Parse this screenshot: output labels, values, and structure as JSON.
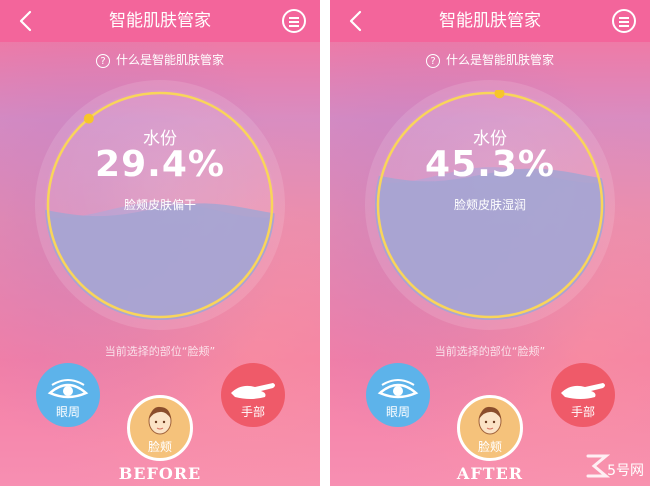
{
  "app": {
    "title": "智能肌肤管家",
    "help_text": "什么是智能肌肤管家",
    "help_icon": "?"
  },
  "panels": [
    {
      "metric_label": "水份",
      "metric_value": "29.4%",
      "moisture_fraction": 0.294,
      "status": "脸颊皮肤偏干",
      "selected_text": "当前选择的部位“脸颊”",
      "zones": {
        "eye": "眼周",
        "face": "脸颊",
        "hand": "手部"
      },
      "caption": "BEFORE"
    },
    {
      "metric_label": "水份",
      "metric_value": "45.3%",
      "moisture_fraction": 0.453,
      "status": "脸颊皮肤湿润",
      "selected_text": "当前选择的部位“脸颊”",
      "zones": {
        "eye": "眼周",
        "face": "脸颊",
        "hand": "手部"
      },
      "caption": "AFTER"
    }
  ],
  "watermark": {
    "text": "5号网"
  },
  "colors": {
    "header": "#f3659b",
    "ring": "#f9d55a",
    "eye_zone": "#5db3ea",
    "face_zone": "#f5c27b",
    "hand_zone": "#ef5a69",
    "wave": "#a9a9d6"
  }
}
